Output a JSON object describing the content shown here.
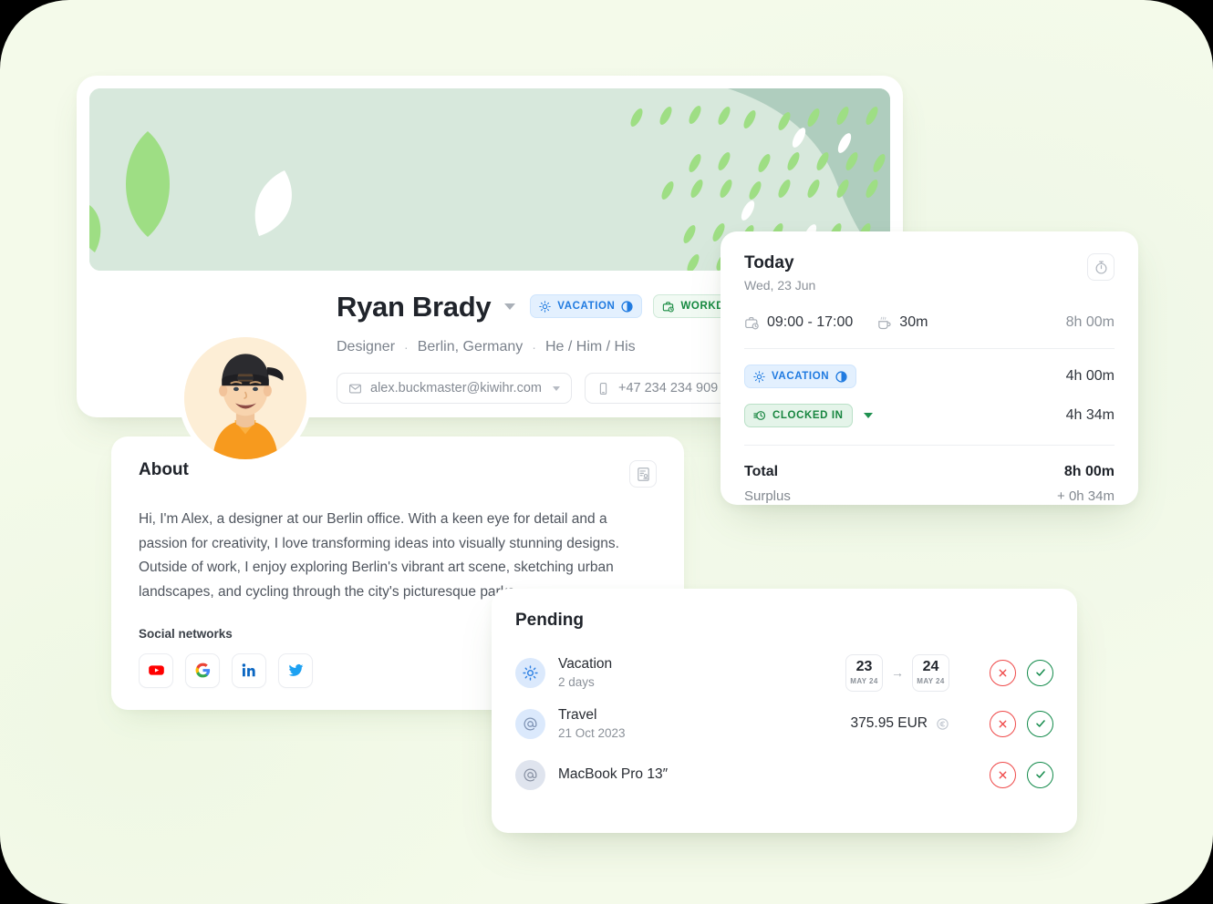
{
  "theme": {
    "page_bg": "#f4faea",
    "card_bg": "#ffffff",
    "banner_bg": "#d7e8dc",
    "accent_green": "#15893f",
    "accent_blue": "#1f7ae0",
    "reject_red": "#ef4a4a",
    "accept_green": "#128a4a",
    "text_primary": "#20242b",
    "text_muted": "#8b9199"
  },
  "profile": {
    "name": "Ryan Brady",
    "name_caret_icon": "chevron-down-icon",
    "badges": [
      {
        "label": "VACATION",
        "icon": "sun-icon",
        "end_icon": "half-circle-icon",
        "color": "#1f7ae0"
      },
      {
        "label": "WORKDAY",
        "icon": "briefcase-clock-icon",
        "end_icon": "half-circle-icon",
        "color": "#15893f"
      }
    ],
    "meta": {
      "role": "Designer",
      "separator": "·",
      "location": "Berlin, Germany",
      "pronouns": "He / Him / His"
    },
    "contacts": [
      {
        "icon": "envelope-icon",
        "value": "alex.buckmaster@kiwihr.com",
        "caret": "chevron-down-icon"
      },
      {
        "icon": "phone-icon",
        "value": "+47 234 234 909",
        "caret": "chevron-down-icon"
      }
    ],
    "avatar_alt": "Profile photo of Ryan Brady"
  },
  "about": {
    "title": "About",
    "action_icon": "document-settings-icon",
    "text": "Hi, I'm Alex, a designer at our Berlin office. With a keen eye for detail and a passion for creativity, I love transforming ideas into visually stunning designs. Outside of work, I enjoy exploring Berlin's vibrant art scene, sketching urban landscapes, and cycling through the city's picturesque parks.",
    "social_label": "Social networks",
    "socials": [
      {
        "name": "youtube-icon",
        "label": "YouTube",
        "color": "#ff0000"
      },
      {
        "name": "google-icon",
        "label": "Google",
        "color": "#4285f4"
      },
      {
        "name": "linkedin-icon",
        "label": "LinkedIn",
        "color": "#0a66c2"
      },
      {
        "name": "twitter-icon",
        "label": "Twitter",
        "color": "#1da1f2"
      }
    ]
  },
  "today": {
    "title": "Today",
    "date": "Wed, 23 Jun",
    "timer_icon": "stopwatch-icon",
    "schedule": {
      "work_icon": "briefcase-clock-icon",
      "work_hours": "09:00 - 17:00",
      "break_icon": "coffee-cup-icon",
      "break_duration": "30m",
      "total": "8h 00m"
    },
    "entries": [
      {
        "badge": "VACATION",
        "badge_icon": "sun-icon",
        "badge_end_icon": "half-circle-icon",
        "style": "vacation",
        "value": "4h 00m",
        "has_dropdown": false
      },
      {
        "badge": "CLOCKED IN",
        "badge_icon": "clock-lines-icon",
        "style": "clocked",
        "value": "4h 34m",
        "has_dropdown": true
      }
    ],
    "totals": {
      "total_label": "Total",
      "total_value": "8h 00m",
      "surplus_label": "Surplus",
      "surplus_value": "+ 0h 34m"
    }
  },
  "pending": {
    "title": "Pending",
    "rows": [
      {
        "icon": "sun-icon",
        "icon_style": "blue",
        "title": "Vacation",
        "subtitle": "2 days",
        "kind": "date-range",
        "date_from": {
          "day": "23",
          "month": "MAY 24"
        },
        "date_arrow": "→",
        "date_to": {
          "day": "24",
          "month": "MAY 24"
        },
        "reject_icon": "close-icon",
        "accept_icon": "check-icon"
      },
      {
        "icon": "at-sign-icon",
        "icon_style": "blue",
        "title": "Travel",
        "subtitle": "21 Oct 2023",
        "kind": "amount",
        "amount": "375.95 EUR",
        "amount_icon": "euro-coin-icon",
        "reject_icon": "close-icon",
        "accept_icon": "check-icon"
      },
      {
        "icon": "at-sign-icon",
        "icon_style": "grey",
        "title": "MacBook Pro 13″",
        "subtitle": "",
        "kind": "none",
        "reject_icon": "close-icon",
        "accept_icon": "check-icon"
      }
    ]
  }
}
